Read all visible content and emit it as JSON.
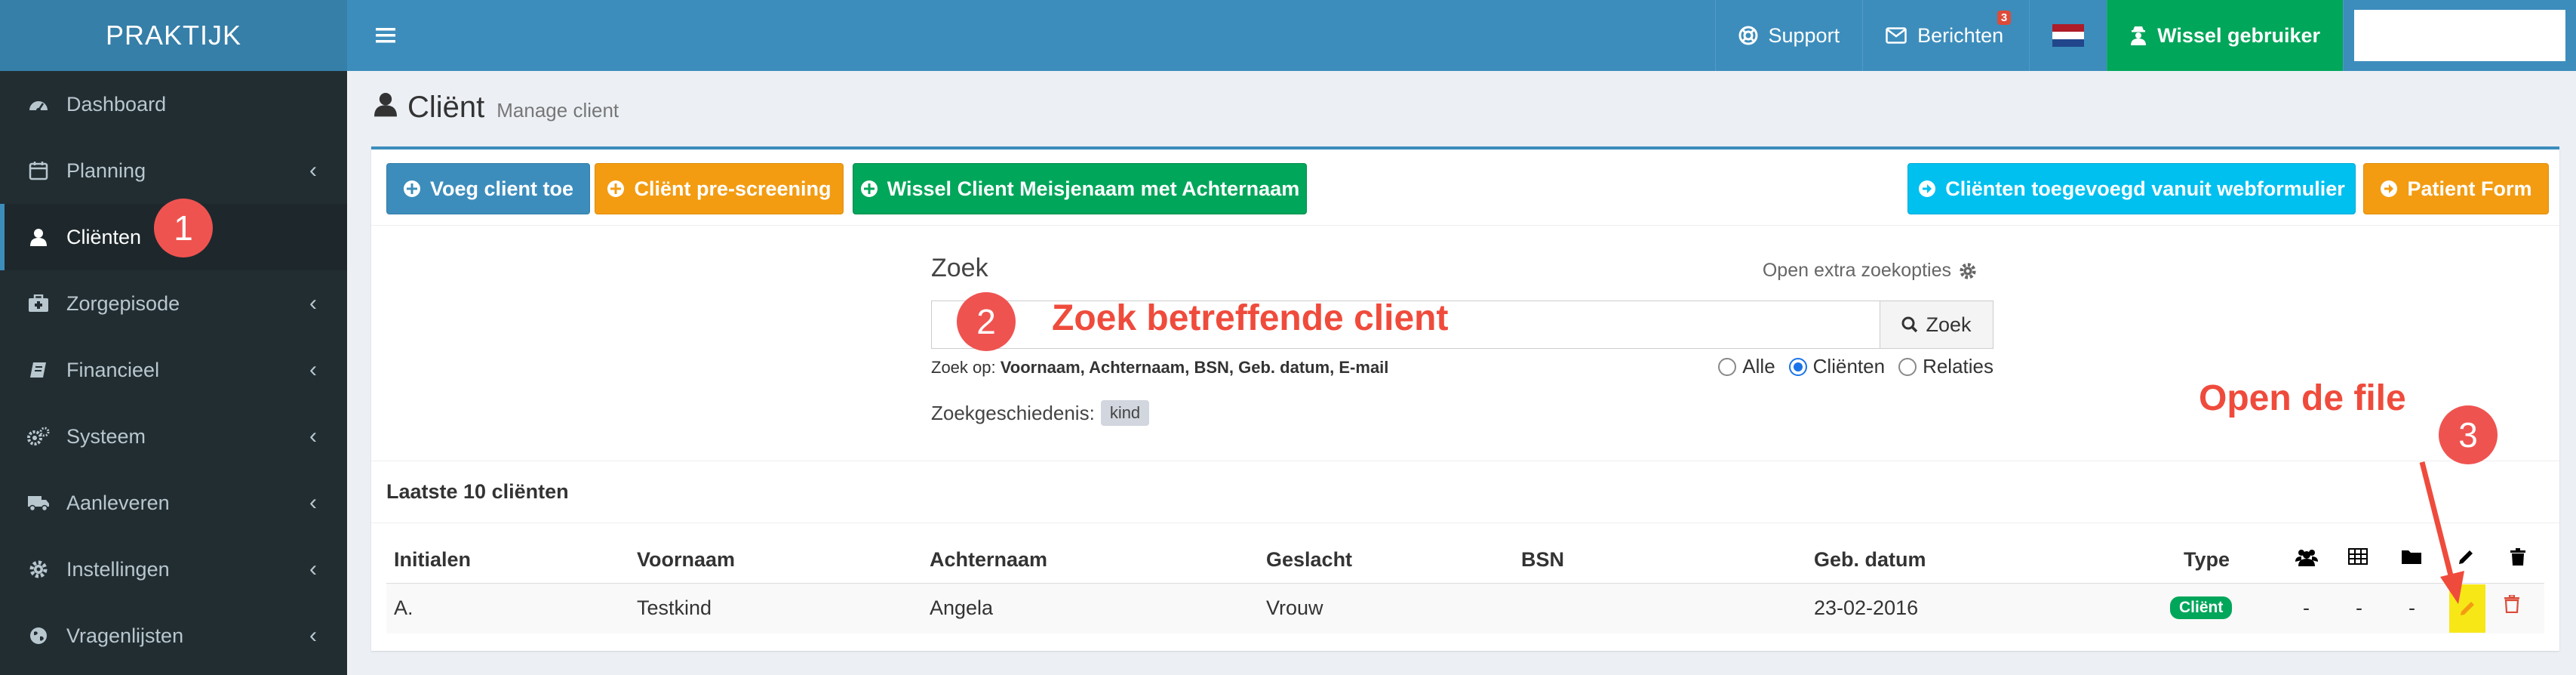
{
  "sidebar": {
    "logo": "PRAKTIJK",
    "items": [
      {
        "label": "Dashboard",
        "icon": "dashboard-icon",
        "has_children": false
      },
      {
        "label": "Planning",
        "icon": "calendar-icon",
        "has_children": true
      },
      {
        "label": "Cliënten",
        "icon": "user-icon",
        "has_children": false,
        "active": true
      },
      {
        "label": "Zorgepisode",
        "icon": "medkit-icon",
        "has_children": true
      },
      {
        "label": "Financieel",
        "icon": "book-icon",
        "has_children": true
      },
      {
        "label": "Systeem",
        "icon": "cogs-icon",
        "has_children": true
      },
      {
        "label": "Aanleveren",
        "icon": "truck-icon",
        "has_children": true
      },
      {
        "label": "Instellingen",
        "icon": "gear-icon",
        "has_children": true
      },
      {
        "label": "Vragenlijsten",
        "icon": "globe-icon",
        "has_children": true
      }
    ]
  },
  "header": {
    "support": "Support",
    "messages": "Berichten",
    "messages_count": "3",
    "switch_user": "Wissel gebruiker"
  },
  "page": {
    "title": "Cliënt",
    "subtitle": "Manage client"
  },
  "toolbar": {
    "add_client": "Voeg client toe",
    "pre_screening": "Cliënt pre-screening",
    "swap_name": "Wissel Client Meisjenaam met Achternaam",
    "webform_clients": "Cliënten toegevoegd vanuit webformulier",
    "patient_form": "Patient Form"
  },
  "search": {
    "label": "Zoek",
    "extra_options": "Open extra zoekopties",
    "button": "Zoek",
    "zoek_op_prefix": "Zoek op:",
    "zoek_op_fields": "Voornaam, Achternaam, BSN, Geb. datum, E-mail",
    "radios": [
      {
        "label": "Alle",
        "checked": false
      },
      {
        "label": "Cliënten",
        "checked": true
      },
      {
        "label": "Relaties",
        "checked": false
      }
    ],
    "history_label": "Zoekgeschiedenis:",
    "history_tag": "kind"
  },
  "latest": {
    "title": "Laatste 10 cliënten",
    "columns": [
      "Initialen",
      "Voornaam",
      "Achternaam",
      "Geslacht",
      "BSN",
      "Geb. datum",
      "Type"
    ],
    "rows": [
      {
        "initialen": "A.",
        "voornaam": "Testkind",
        "achternaam": "Angela",
        "geslacht": "Vrouw",
        "bsn": "",
        "geb_datum": "23-02-2016",
        "type": "Cliënt",
        "col_a": "-",
        "col_b": "-",
        "col_c": "-"
      }
    ]
  },
  "annotations": {
    "n1": "1",
    "n2": "2",
    "n3": "3",
    "text2": "Zoek betreffende client",
    "text3": "Open de file"
  },
  "colors": {
    "header": "#3c8dbc",
    "sidebar": "#222d32",
    "green": "#00a65a",
    "orange": "#f39c12",
    "aqua": "#00c0ef",
    "annotation_red": "#ef4b3c",
    "highlight_yellow": "#f7e717"
  }
}
